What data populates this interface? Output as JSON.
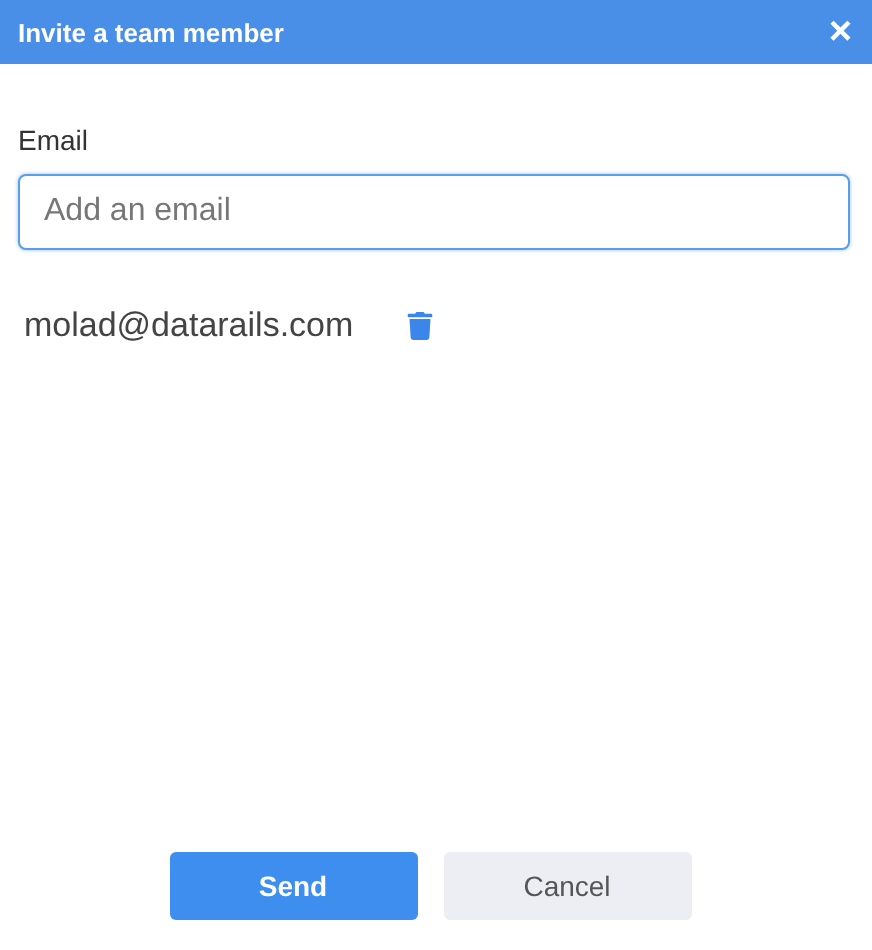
{
  "dialog": {
    "title": "Invite a team member",
    "close": "×"
  },
  "email_field": {
    "label": "Email",
    "placeholder": "Add an email",
    "focused": true
  },
  "invited": [
    {
      "email": "molad@datarails.com"
    }
  ],
  "buttons": [
    {
      "label": "Send",
      "kind": "primary"
    },
    {
      "label": "Cancel",
      "kind": "secondary"
    }
  ]
}
